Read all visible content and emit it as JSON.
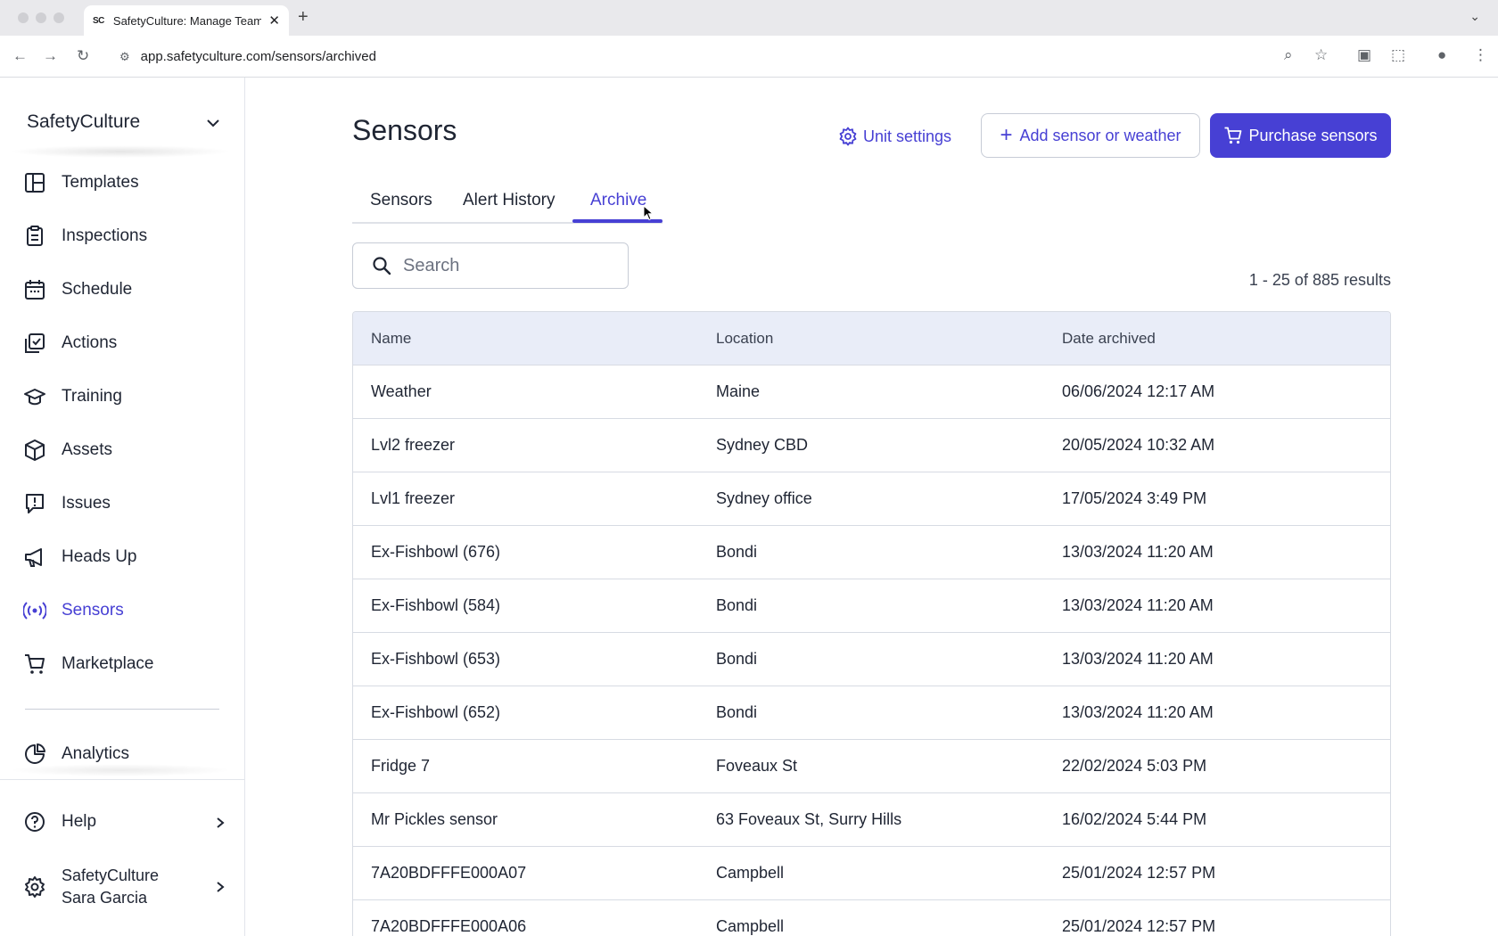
{
  "browser": {
    "tab_title": "SafetyCulture: Manage Teams",
    "favicon_text": "SC",
    "url": "app.safetyculture.com/sensors/archived"
  },
  "sidebar": {
    "org_name": "SafetyCulture",
    "items": [
      {
        "label": "Templates",
        "icon": "templates-icon"
      },
      {
        "label": "Inspections",
        "icon": "inspections-icon"
      },
      {
        "label": "Schedule",
        "icon": "calendar-icon"
      },
      {
        "label": "Actions",
        "icon": "actions-icon"
      },
      {
        "label": "Training",
        "icon": "graduation-cap-icon"
      },
      {
        "label": "Assets",
        "icon": "cube-icon"
      },
      {
        "label": "Issues",
        "icon": "alert-bubble-icon"
      },
      {
        "label": "Heads Up",
        "icon": "megaphone-icon"
      },
      {
        "label": "Sensors",
        "icon": "broadcast-icon"
      },
      {
        "label": "Marketplace",
        "icon": "cart-icon"
      }
    ],
    "analytics": "Analytics",
    "help": "Help",
    "user_org": "SafetyCulture",
    "user_name": "Sara Garcia",
    "active_item": "Sensors"
  },
  "main": {
    "title": "Sensors",
    "unit_settings": "Unit settings",
    "add_sensor": "Add sensor or weather",
    "purchase": "Purchase sensors",
    "tabs": [
      "Sensors",
      "Alert History",
      "Archive"
    ],
    "active_tab": "Archive",
    "search_placeholder": "Search",
    "results_text": "1 - 25 of 885 results",
    "table": {
      "headers": [
        "Name",
        "Location",
        "Date archived"
      ],
      "rows": [
        [
          "Weather",
          "Maine",
          "06/06/2024 12:17 AM"
        ],
        [
          "Lvl2 freezer",
          "Sydney CBD",
          "20/05/2024 10:32 AM"
        ],
        [
          "Lvl1 freezer",
          "Sydney office",
          "17/05/2024 3:49 PM"
        ],
        [
          "Ex-Fishbowl (676)",
          "Bondi",
          "13/03/2024 11:20 AM"
        ],
        [
          "Ex-Fishbowl (584)",
          "Bondi",
          "13/03/2024 11:20 AM"
        ],
        [
          "Ex-Fishbowl (653)",
          "Bondi",
          "13/03/2024 11:20 AM"
        ],
        [
          "Ex-Fishbowl (652)",
          "Bondi",
          "13/03/2024 11:20 AM"
        ],
        [
          "Fridge 7",
          "Foveaux St",
          "22/02/2024 5:03 PM"
        ],
        [
          "Mr Pickles sensor",
          "63 Foveaux St, Surry Hills",
          "16/02/2024 5:44 PM"
        ],
        [
          "7A20BDFFFE000A07",
          "Campbell",
          "25/01/2024 12:57 PM"
        ],
        [
          "7A20BDFFFE000A06",
          "Campbell",
          "25/01/2024 12:57 PM"
        ]
      ]
    }
  },
  "colors": {
    "accent": "#4740d4",
    "table_header_bg": "#e9edf8",
    "border": "#d7dbe3",
    "text": "#1f2533"
  }
}
